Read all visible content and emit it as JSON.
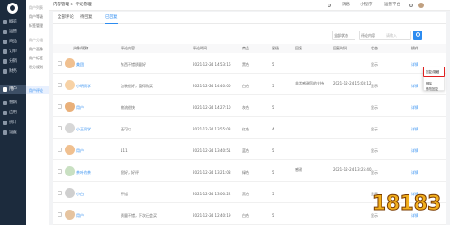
{
  "sidebar": {
    "items": [
      {
        "label": "概览",
        "active": false
      },
      {
        "label": "运营",
        "active": false
      },
      {
        "label": "商品",
        "active": false
      },
      {
        "label": "订单",
        "active": false
      },
      {
        "label": "用户",
        "active": true
      },
      {
        "label": "分销",
        "active": false
      },
      {
        "label": "财务",
        "active": false
      },
      {
        "label": "营销",
        "active": false
      },
      {
        "label": "应用",
        "active": false
      },
      {
        "label": "统计",
        "active": false
      },
      {
        "label": "设置",
        "active": false
      }
    ]
  },
  "subnav": {
    "items": [
      "用户列表",
      "用户等级",
      "标签管理",
      "用户分组",
      "用户画像",
      "用户标签",
      "积分规则",
      "用户评论"
    ]
  },
  "topbar": {
    "breadcrumb": "内容管理 > 评论管理",
    "items": [
      "消息",
      "小程序",
      "运营平台"
    ]
  },
  "tabs": [
    "全部评论",
    "待回复",
    "已回复"
  ],
  "filters": {
    "label1": "全部状态",
    "label2": "评论内容",
    "placeholder": "请输入"
  },
  "table": {
    "headers": [
      "头像/昵称",
      "评论内容",
      "评论时间",
      "商品",
      "星级",
      "回复",
      "回复时间",
      "状态",
      "操作"
    ],
    "rows": [
      {
        "nick": "美团",
        "content": "东西不错质量好",
        "time": "2021-12-24 14:53:16",
        "product": "黑色",
        "stars": "5",
        "reply": "",
        "reply_time": "",
        "status": "显示",
        "action": "详情"
      },
      {
        "nick": "小明同学",
        "content": "包装很好，值得购买",
        "time": "2021-12-24 14:40:00",
        "product": "白色",
        "stars": "5",
        "reply": "非常感谢您的支持",
        "reply_time": "2021-12-24 15:03:12",
        "status": "显示",
        "action": "详情"
      },
      {
        "nick": "用户",
        "content": "物流很快",
        "time": "2021-12-24 14:27:10",
        "product": "灰色",
        "stars": "5",
        "reply": "",
        "reply_time": "",
        "status": "显示",
        "action": "详情"
      },
      {
        "nick": "小王同学",
        "content": "还可以",
        "time": "2021-12-24 13:55:03",
        "product": "红色",
        "stars": "4",
        "reply": "",
        "reply_time": "",
        "status": "显示",
        "action": "详情"
      },
      {
        "nick": "用户",
        "content": "111",
        "time": "2021-12-24 13:40:51",
        "product": "蓝色",
        "stars": "5",
        "reply": "",
        "reply_time": "",
        "status": "显示",
        "action": "详情"
      },
      {
        "nick": "茶叶的茶",
        "content": "很好，好评",
        "time": "2021-12-24 13:21:08",
        "product": "绿色",
        "stars": "5",
        "reply": "感谢",
        "reply_time": "2021-12-24 13:25:40",
        "status": "显示",
        "action": "详情"
      },
      {
        "nick": "小白",
        "content": "不错",
        "time": "2021-12-24 13:00:22",
        "product": "黑色",
        "stars": "5",
        "reply": "",
        "reply_time": "",
        "status": "显示",
        "action": "详情"
      },
      {
        "nick": "用户",
        "content": "质量不错，下次还会买",
        "time": "2021-12-24 12:40:19",
        "product": "白色",
        "stars": "5",
        "reply": "",
        "reply_time": "",
        "status": "显示",
        "action": "详情"
      }
    ]
  },
  "dropdown": {
    "highlight": "回复/隐藏",
    "items": [
      "删除",
      "修改回复"
    ]
  },
  "watermark": "18183",
  "colors": {
    "accent": "#2d8cf0",
    "sidebar": "#1c2b3d",
    "highlight": "#e02020"
  }
}
